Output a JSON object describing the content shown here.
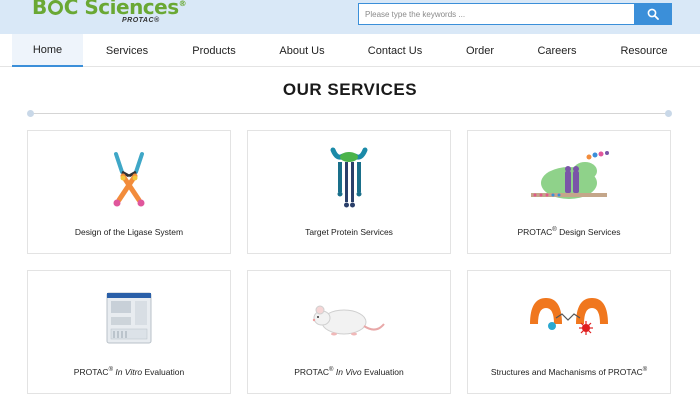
{
  "header": {
    "logo_text": "B◌C Sciences",
    "logo_reg": "®",
    "logo_sub": "PROTAC®",
    "search_placeholder": "Please type the keywords ...",
    "search_icon": "magnifier-icon"
  },
  "nav": {
    "items": [
      {
        "label": "Home"
      },
      {
        "label": "Services"
      },
      {
        "label": "Products"
      },
      {
        "label": "About Us"
      },
      {
        "label": "Contact Us"
      },
      {
        "label": "Order"
      },
      {
        "label": "Careers"
      },
      {
        "label": "Resource"
      }
    ],
    "active": "Home",
    "accent_color": "#3b8fd9"
  },
  "section": {
    "title": "OUR SERVICES"
  },
  "cards": [
    {
      "label": "Design of the Ligase System",
      "icon": "ligase-antibody-icon"
    },
    {
      "label": "Target Protein Services",
      "icon": "target-protein-icon"
    },
    {
      "label_prefix": "PROTAC",
      "label_sup": "®",
      "label_suffix": " Design Services",
      "icon": "protac-design-icon"
    },
    {
      "label_prefix": "PROTAC",
      "label_sup": "®",
      "label_italic": " In Vitro",
      "label_suffix": " Evaluation",
      "icon": "lab-instrument-icon"
    },
    {
      "label_prefix": "PROTAC",
      "label_sup": "®",
      "label_italic": " In Vivo",
      "label_suffix": " Evaluation",
      "icon": "mouse-icon"
    },
    {
      "label_prefix": "Structures and Machanisms of PROTAC",
      "label_sup": "®",
      "icon": "protac-mechanism-icon"
    }
  ],
  "colors": {
    "brand_green": "#6aa834",
    "header_bg": "#d9e8f7",
    "accent_blue": "#3b8fd9"
  }
}
